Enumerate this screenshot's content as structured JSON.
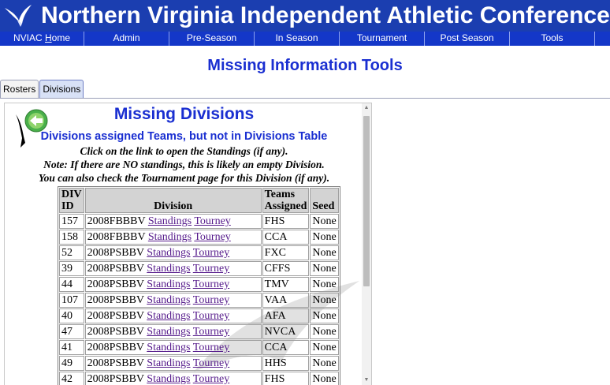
{
  "header": {
    "title": "Northern Virginia Independent Athletic Conference"
  },
  "nav": {
    "items": [
      {
        "label_pre": "NVIAC ",
        "label_ul": "H",
        "label_post": "ome"
      },
      {
        "label_pre": "Admin",
        "label_ul": "",
        "label_post": ""
      },
      {
        "label_pre": "Pre-Season",
        "label_ul": "",
        "label_post": ""
      },
      {
        "label_pre": "In Season",
        "label_ul": "",
        "label_post": ""
      },
      {
        "label_pre": "Tournament",
        "label_ul": "",
        "label_post": ""
      },
      {
        "label_pre": "Post Season",
        "label_ul": "",
        "label_post": ""
      },
      {
        "label_pre": "Tools",
        "label_ul": "",
        "label_post": ""
      }
    ]
  },
  "page": {
    "title": "Missing Information Tools"
  },
  "tabs": [
    {
      "label": "Rosters",
      "active": false
    },
    {
      "label": "Divisions",
      "active": true
    }
  ],
  "panel": {
    "heading": "Missing Divisions",
    "subheading": "Divisions assigned Teams, but not in Divisions Table",
    "notes": [
      "Click on the link to open the Standings (if any).",
      "Note: If there are NO standings, this is likely an empty Division.",
      "You can also check the Tournament page for this Division (if any)."
    ]
  },
  "table": {
    "headers": {
      "div_id_1": "DIV",
      "div_id_2": "ID",
      "division": "Division",
      "teams_1": "Teams",
      "teams_2": "Assigned",
      "seed": "Seed"
    },
    "link_standings": "Standings",
    "link_tourney": "Tourney",
    "rows": [
      {
        "id": "157",
        "division": "2008FBBBV",
        "team": "FHS",
        "seed": "None"
      },
      {
        "id": "158",
        "division": "2008FBBBV",
        "team": "CCA",
        "seed": "None"
      },
      {
        "id": "52",
        "division": "2008PSBBV",
        "team": "FXC",
        "seed": "None"
      },
      {
        "id": "39",
        "division": "2008PSBBV",
        "team": "CFFS",
        "seed": "None"
      },
      {
        "id": "44",
        "division": "2008PSBBV",
        "team": "TMV",
        "seed": "None"
      },
      {
        "id": "107",
        "division": "2008PSBBV",
        "team": "VAA",
        "seed": "None"
      },
      {
        "id": "40",
        "division": "2008PSBBV",
        "team": "AFA",
        "seed": "None"
      },
      {
        "id": "47",
        "division": "2008PSBBV",
        "team": "NVCA",
        "seed": "None"
      },
      {
        "id": "41",
        "division": "2008PSBBV",
        "team": "CCA",
        "seed": "None"
      },
      {
        "id": "49",
        "division": "2008PSBBV",
        "team": "HHS",
        "seed": "None"
      },
      {
        "id": "42",
        "division": "2008PSBBV",
        "team": "FHS",
        "seed": "None"
      }
    ]
  },
  "colors": {
    "banner": "#1b3eb0",
    "nav": "#1437c8",
    "heading": "#1a2fd1",
    "link_visited": "#551a8b",
    "header_cell": "#d3d3d3"
  }
}
